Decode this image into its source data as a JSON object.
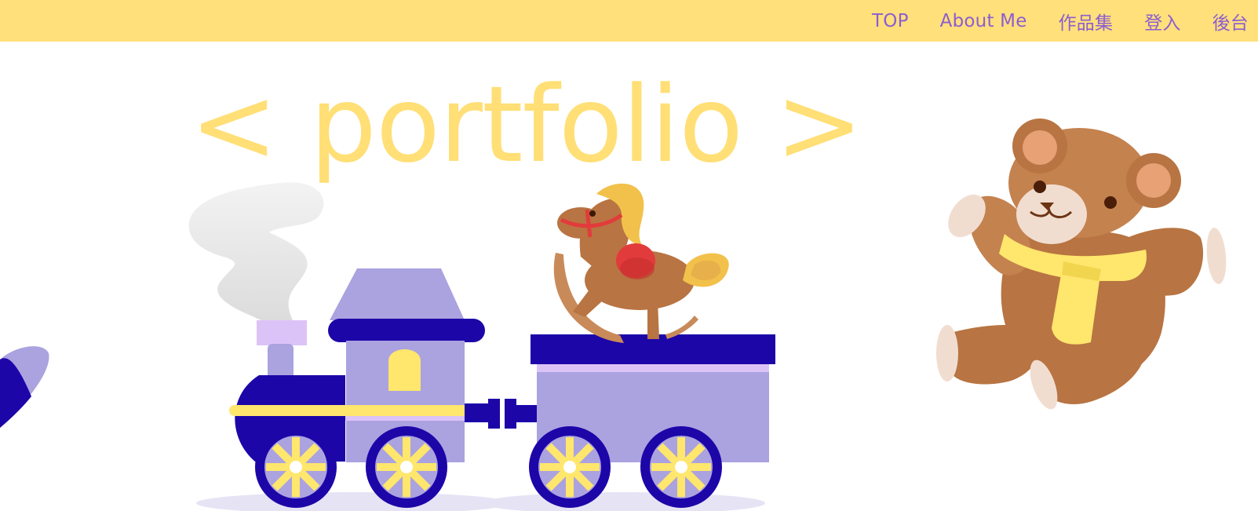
{
  "nav": {
    "items": [
      {
        "label": "TOP"
      },
      {
        "label": "About Me"
      },
      {
        "label": "作品集"
      },
      {
        "label": "登入"
      },
      {
        "label": "後台"
      }
    ]
  },
  "hero": {
    "title": "< portfolio >"
  },
  "colors": {
    "navbar_bg": "#ffe07a",
    "nav_text": "#8c5ed1",
    "title": "#ffdf76",
    "train_dark": "#1c06a8",
    "train_light": "#aba2e0",
    "bear_brown": "#b87442"
  },
  "illustrations": [
    "toy-train-icon",
    "rocking-horse-icon",
    "teddy-bear-icon",
    "toy-plane-icon"
  ]
}
